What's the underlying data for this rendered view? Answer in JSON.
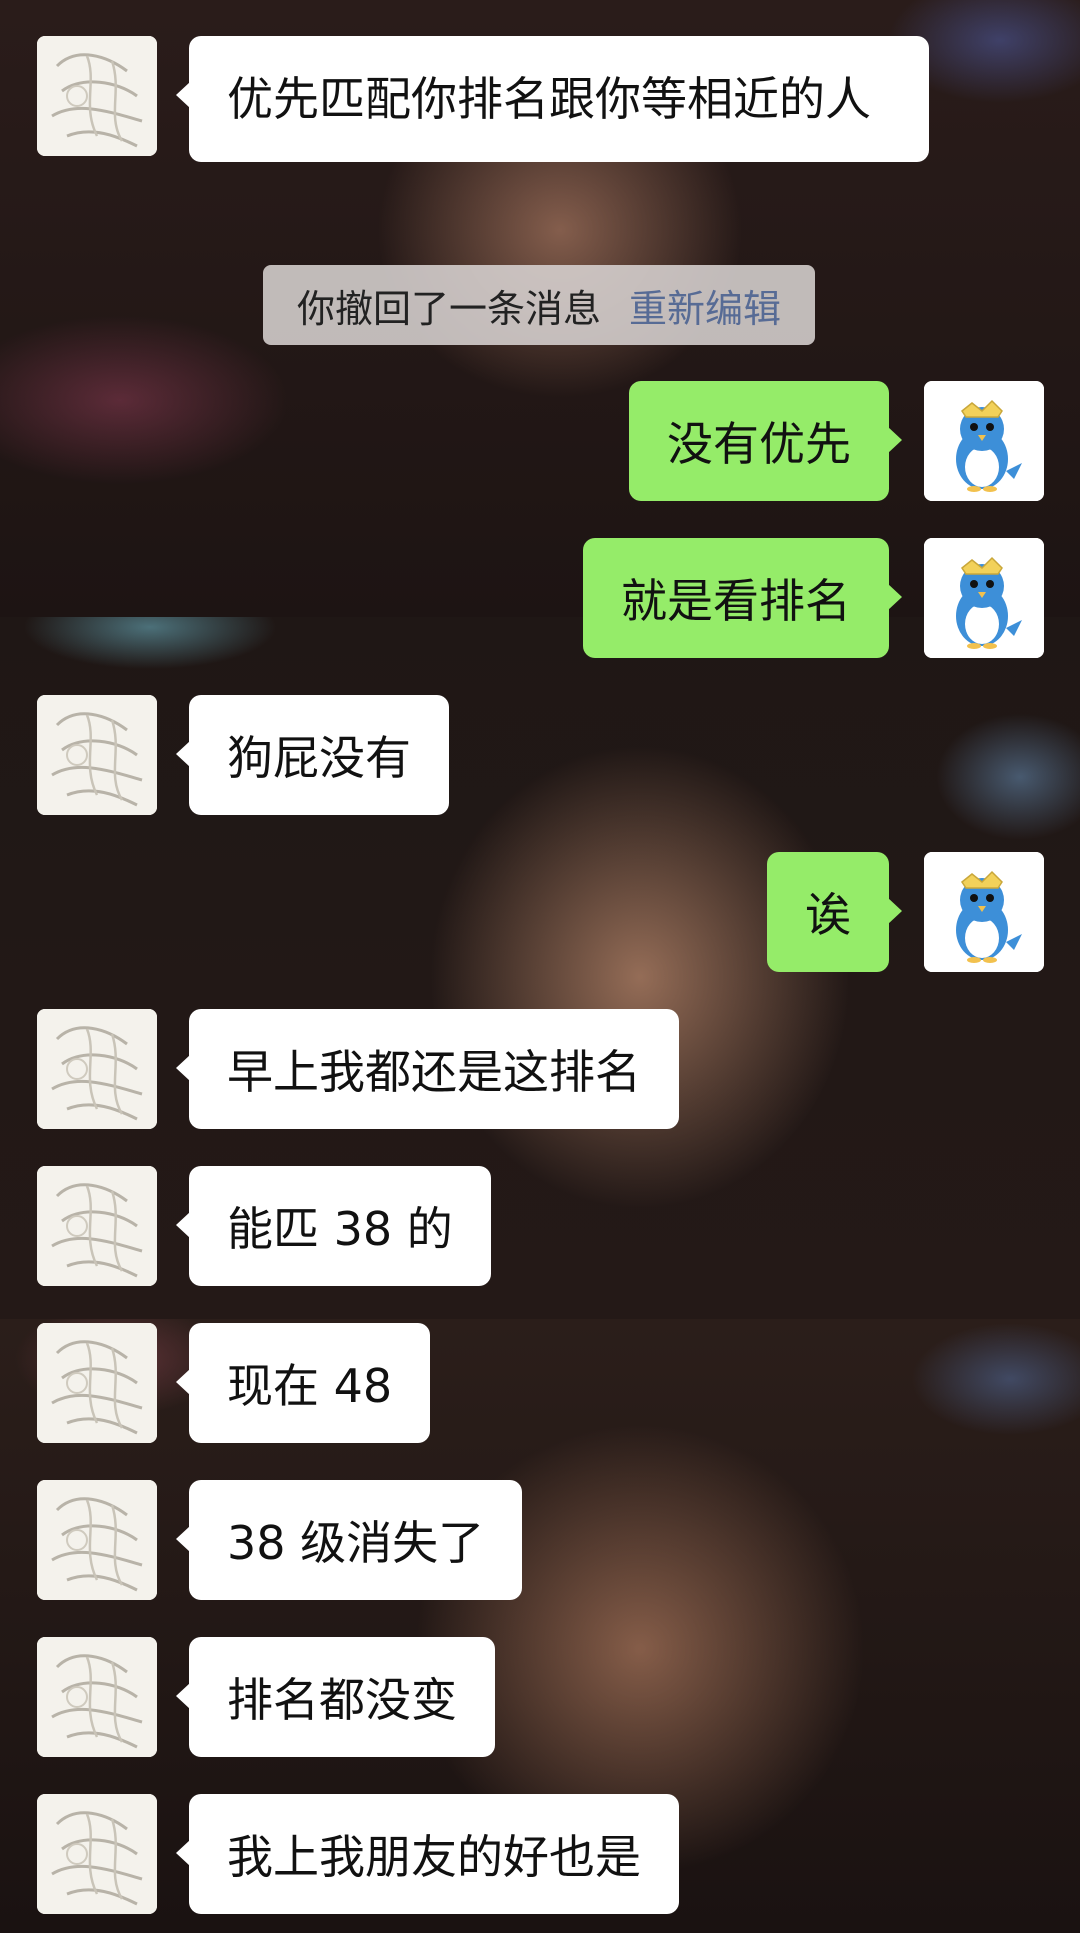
{
  "colors": {
    "incoming_bubble": "#ffffff",
    "outgoing_bubble": "#95ec69",
    "recall_link": "#576b95"
  },
  "avatars": {
    "other": "sketch-avatar-icon",
    "self": "blue-bird-mascot-icon"
  },
  "messages": [
    {
      "from": "other",
      "text": "优先匹配你排名跟你等相近的人"
    },
    {
      "system": true,
      "text": "你撤回了一条消息",
      "action": "重新编辑"
    },
    {
      "from": "me",
      "text": "没有优先"
    },
    {
      "from": "me",
      "text": "就是看排名"
    },
    {
      "from": "other",
      "text": "狗屁没有"
    },
    {
      "from": "me",
      "text": "诶"
    },
    {
      "from": "other",
      "text": "早上我都还是这排名"
    },
    {
      "from": "other",
      "text": "能匹 38 的"
    },
    {
      "from": "other",
      "text": "现在 48"
    },
    {
      "from": "other",
      "text": "38 级消失了"
    },
    {
      "from": "other",
      "text": "排名都没变"
    },
    {
      "from": "other",
      "text": "我上我朋友的好也是"
    }
  ]
}
